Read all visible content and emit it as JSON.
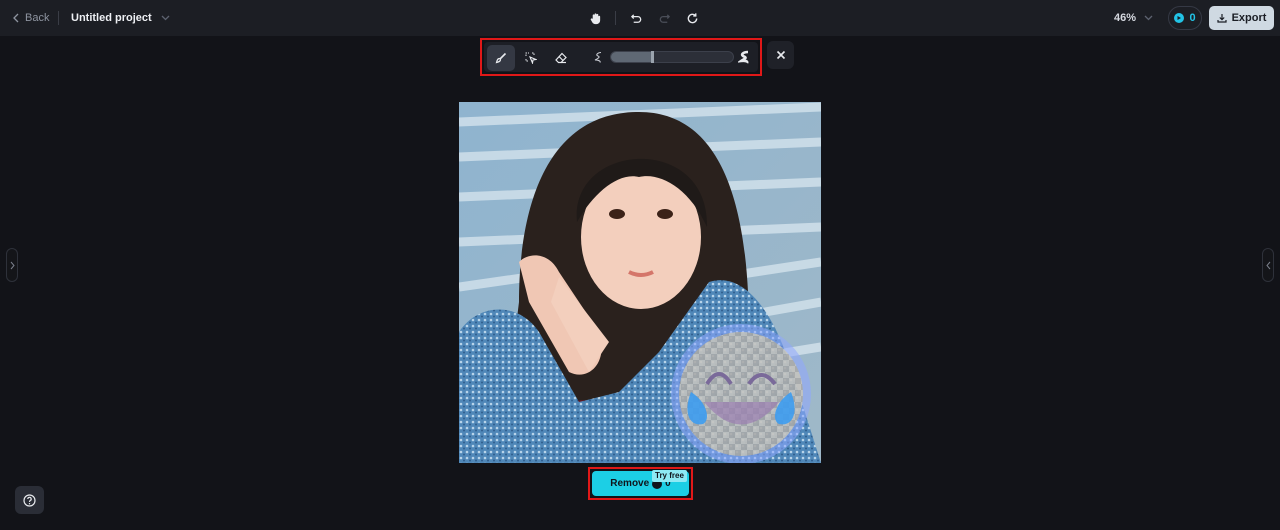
{
  "topbar": {
    "back_label": "Back",
    "project_title": "Untitled project",
    "zoom_level": "46%",
    "credits_count": "0",
    "export_label": "Export"
  },
  "center_tools": [
    {
      "name": "hand-tool",
      "icon": "hand-icon"
    },
    {
      "name": "undo",
      "icon": "undo-icon"
    },
    {
      "name": "redo",
      "icon": "redo-icon",
      "disabled": true
    },
    {
      "name": "reset",
      "icon": "refresh-icon"
    }
  ],
  "brush_toolbar": {
    "tools": [
      {
        "name": "brush",
        "icon": "brush-icon",
        "active": true
      },
      {
        "name": "lasso-select",
        "icon": "select-cursor-icon",
        "active": false
      },
      {
        "name": "eraser",
        "icon": "eraser-icon",
        "active": false
      }
    ],
    "brush_size_fraction": 0.34
  },
  "canvas": {
    "image_description": "Portrait photo of a young woman in a denim jacket with a laughing-with-tears emoji overlay selected for removal"
  },
  "remove_button": {
    "label": "Remove",
    "cost": "0",
    "badge": "Try free"
  },
  "colors": {
    "accent": "#1ccfe5",
    "highlight_border": "#e01818",
    "background": "#121318",
    "topbar": "#1c1e24"
  }
}
